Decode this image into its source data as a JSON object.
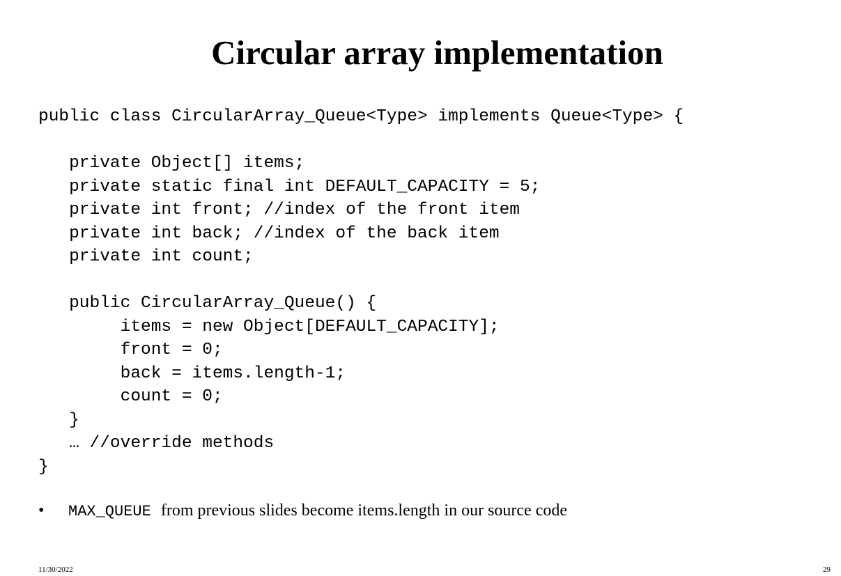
{
  "title": "Circular array implementation",
  "code_lines": [
    "public class CircularArray_Queue<Type> implements Queue<Type> {",
    "",
    "   private Object[] items;",
    "   private static final int DEFAULT_CAPACITY = 5;",
    "   private int front; //index of the front item",
    "   private int back; //index of the back item",
    "   private int count;",
    "",
    "   public CircularArray_Queue() {",
    "        items = new Object[DEFAULT_CAPACITY];",
    "        front = 0;",
    "        back = items.length-1;",
    "        count = 0;",
    "   }",
    "   … //override methods",
    "}"
  ],
  "bullet": {
    "symbol": "•",
    "code": "MAX_QUEUE",
    "text": "from previous slides become items.length in our source code"
  },
  "footer": {
    "date": "11/30/2022",
    "page_number": "29"
  }
}
